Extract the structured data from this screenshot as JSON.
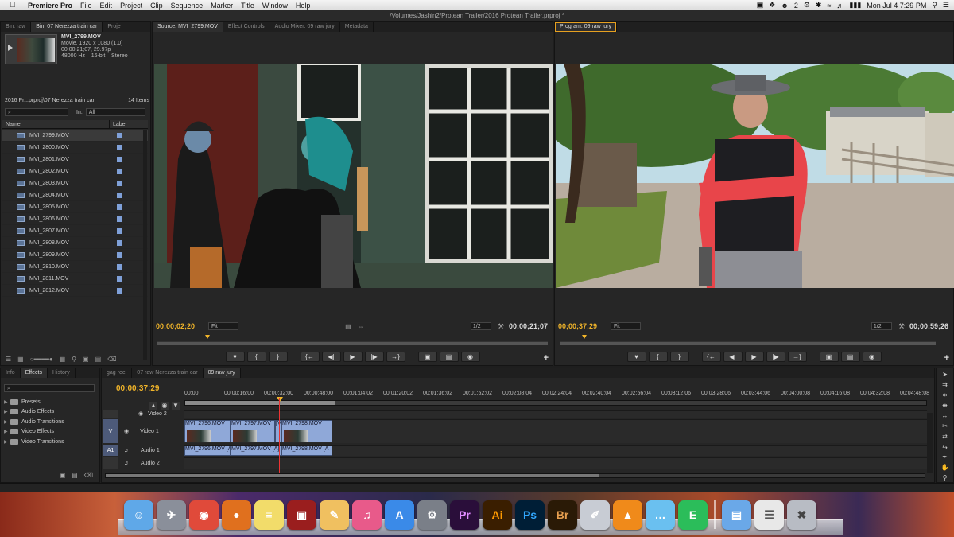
{
  "menubar": {
    "app_name": "Premiere Pro",
    "items": [
      "File",
      "Edit",
      "Project",
      "Clip",
      "Sequence",
      "Marker",
      "Title",
      "Window",
      "Help"
    ],
    "status": {
      "notification_count": "2",
      "datetime": "Mon Jul 4  7:29 PM"
    }
  },
  "window": {
    "title": "/Volumes/Jashin2/Protean Trailer/2016 Protean Trailer.prproj *"
  },
  "project_panel": {
    "tabs": [
      "Bin: raw",
      "Bin: 07 Nerezza train car",
      "Proje"
    ],
    "selected_clip": {
      "name": "MVI_2799.MOV",
      "line1": "Movie, 1920 x 1080 (1.0)",
      "line2": "00;00;21;07, 29.97p",
      "line3": "48000 Hz – 16-bit – Stereo"
    },
    "path": "2016 Pr...prproj\\07 Nerezza train car",
    "item_count": "14 Items",
    "search_placeholder": "⌕",
    "in_label": "In:",
    "in_value": "All",
    "col_name": "Name",
    "col_label": "Label",
    "clips": [
      "MVI_2799.MOV",
      "MVI_2800.MOV",
      "MVI_2801.MOV",
      "MVI_2802.MOV",
      "MVI_2803.MOV",
      "MVI_2804.MOV",
      "MVI_2805.MOV",
      "MVI_2806.MOV",
      "MVI_2807.MOV",
      "MVI_2808.MOV",
      "MVI_2809.MOV",
      "MVI_2810.MOV",
      "MVI_2811.MOV",
      "MVI_2812.MOV"
    ]
  },
  "source_monitor": {
    "tabs": [
      "Source: MVI_2799.MOV",
      "Effect Controls",
      "Audio Mixer: 09 raw jury",
      "Metadata"
    ],
    "timecode_current": "00;00;02;20",
    "fit": "Fit",
    "resolution": "1/2",
    "timecode_duration": "00;00;21;07"
  },
  "program_monitor": {
    "tab": "Program: 09 raw jury",
    "timecode_current": "00;00;37;29",
    "fit": "Fit",
    "resolution": "1/2",
    "timecode_duration": "00;00;59;26"
  },
  "effects_panel": {
    "tabs": [
      "Info",
      "Effects",
      "History"
    ],
    "items": [
      "Presets",
      "Audio Effects",
      "Audio Transitions",
      "Video Effects",
      "Video Transitions"
    ]
  },
  "timeline": {
    "tabs": [
      "gag reel",
      "07 raw Nerezza train car",
      "09 raw jury"
    ],
    "timecode": "00;00;37;29",
    "ruler": [
      "00;00",
      "00;00;16;00",
      "00;00;32;00",
      "00;00;48;00",
      "00;01;04;02",
      "00;01;20;02",
      "00;01;36;02",
      "00;01;52;02",
      "00;02;08;04",
      "00;02;24;04",
      "00;02;40;04",
      "00;02;56;04",
      "00;03;12;06",
      "00;03;28;06",
      "00;03;44;06",
      "00;04;00;08",
      "00;04;16;08",
      "00;04;32;08",
      "00;04;48;08"
    ],
    "tracks": {
      "video2": "Video 2",
      "video1": "Video 1",
      "audio1": "Audio 1",
      "audio2": "Audio 2",
      "v_toggle": "V",
      "a_toggle": "A1"
    },
    "video_clips": [
      "MVI_2796.MOV",
      "MVI_2797.MOV",
      "[V",
      "MVI_2798.MOV"
    ],
    "audio_clips": [
      "MVI_2796.MOV [A]",
      "MVI_2797.MOV [A]",
      "MVI_2798.MOV [A"
    ]
  },
  "dock": {
    "apps": [
      {
        "name": "Finder",
        "color": "#5fa8e8",
        "glyph": "☺"
      },
      {
        "name": "Launchpad",
        "color": "#8a8f9a",
        "glyph": "✈"
      },
      {
        "name": "Chrome",
        "color": "#e04a3a",
        "glyph": "◉"
      },
      {
        "name": "Firefox",
        "color": "#e0701e",
        "glyph": "●"
      },
      {
        "name": "Stickies",
        "color": "#f2dc6a",
        "glyph": "≡"
      },
      {
        "name": "Photo Booth",
        "color": "#9a1e1e",
        "glyph": "▣"
      },
      {
        "name": "TextEdit",
        "color": "#f0c060",
        "glyph": "✎"
      },
      {
        "name": "iTunes",
        "color": "#e85a8a",
        "glyph": "♫"
      },
      {
        "name": "App Store",
        "color": "#3a8ae8",
        "glyph": "A"
      },
      {
        "name": "System Preferences",
        "color": "#7a7f88",
        "glyph": "⚙"
      },
      {
        "name": "Premiere Pro",
        "color": "#2a0e3a",
        "glyph": "Pr",
        "fg": "#e08aff"
      },
      {
        "name": "Illustrator",
        "color": "#3a1e00",
        "glyph": "Ai",
        "fg": "#ff9a00"
      },
      {
        "name": "Photoshop",
        "color": "#001e36",
        "glyph": "Ps",
        "fg": "#31a8ff"
      },
      {
        "name": "Bridge",
        "color": "#2a1a06",
        "glyph": "Br",
        "fg": "#e8a050"
      },
      {
        "name": "Preview",
        "color": "#c8ccd4",
        "glyph": "✐"
      },
      {
        "name": "VLC",
        "color": "#f08a1a",
        "glyph": "▲"
      },
      {
        "name": "Messages",
        "color": "#6ac0f0",
        "glyph": "…"
      },
      {
        "name": "Evernote",
        "color": "#2bbd5a",
        "glyph": "E"
      }
    ],
    "trailing": [
      {
        "name": "Applications folder",
        "color": "#6aa8e8",
        "glyph": "▤"
      },
      {
        "name": "Documents",
        "color": "#e8e8e8",
        "glyph": "☰",
        "fg": "#555"
      },
      {
        "name": "Trash",
        "color": "#b8bcc4",
        "glyph": "✖",
        "fg": "#444"
      }
    ]
  }
}
